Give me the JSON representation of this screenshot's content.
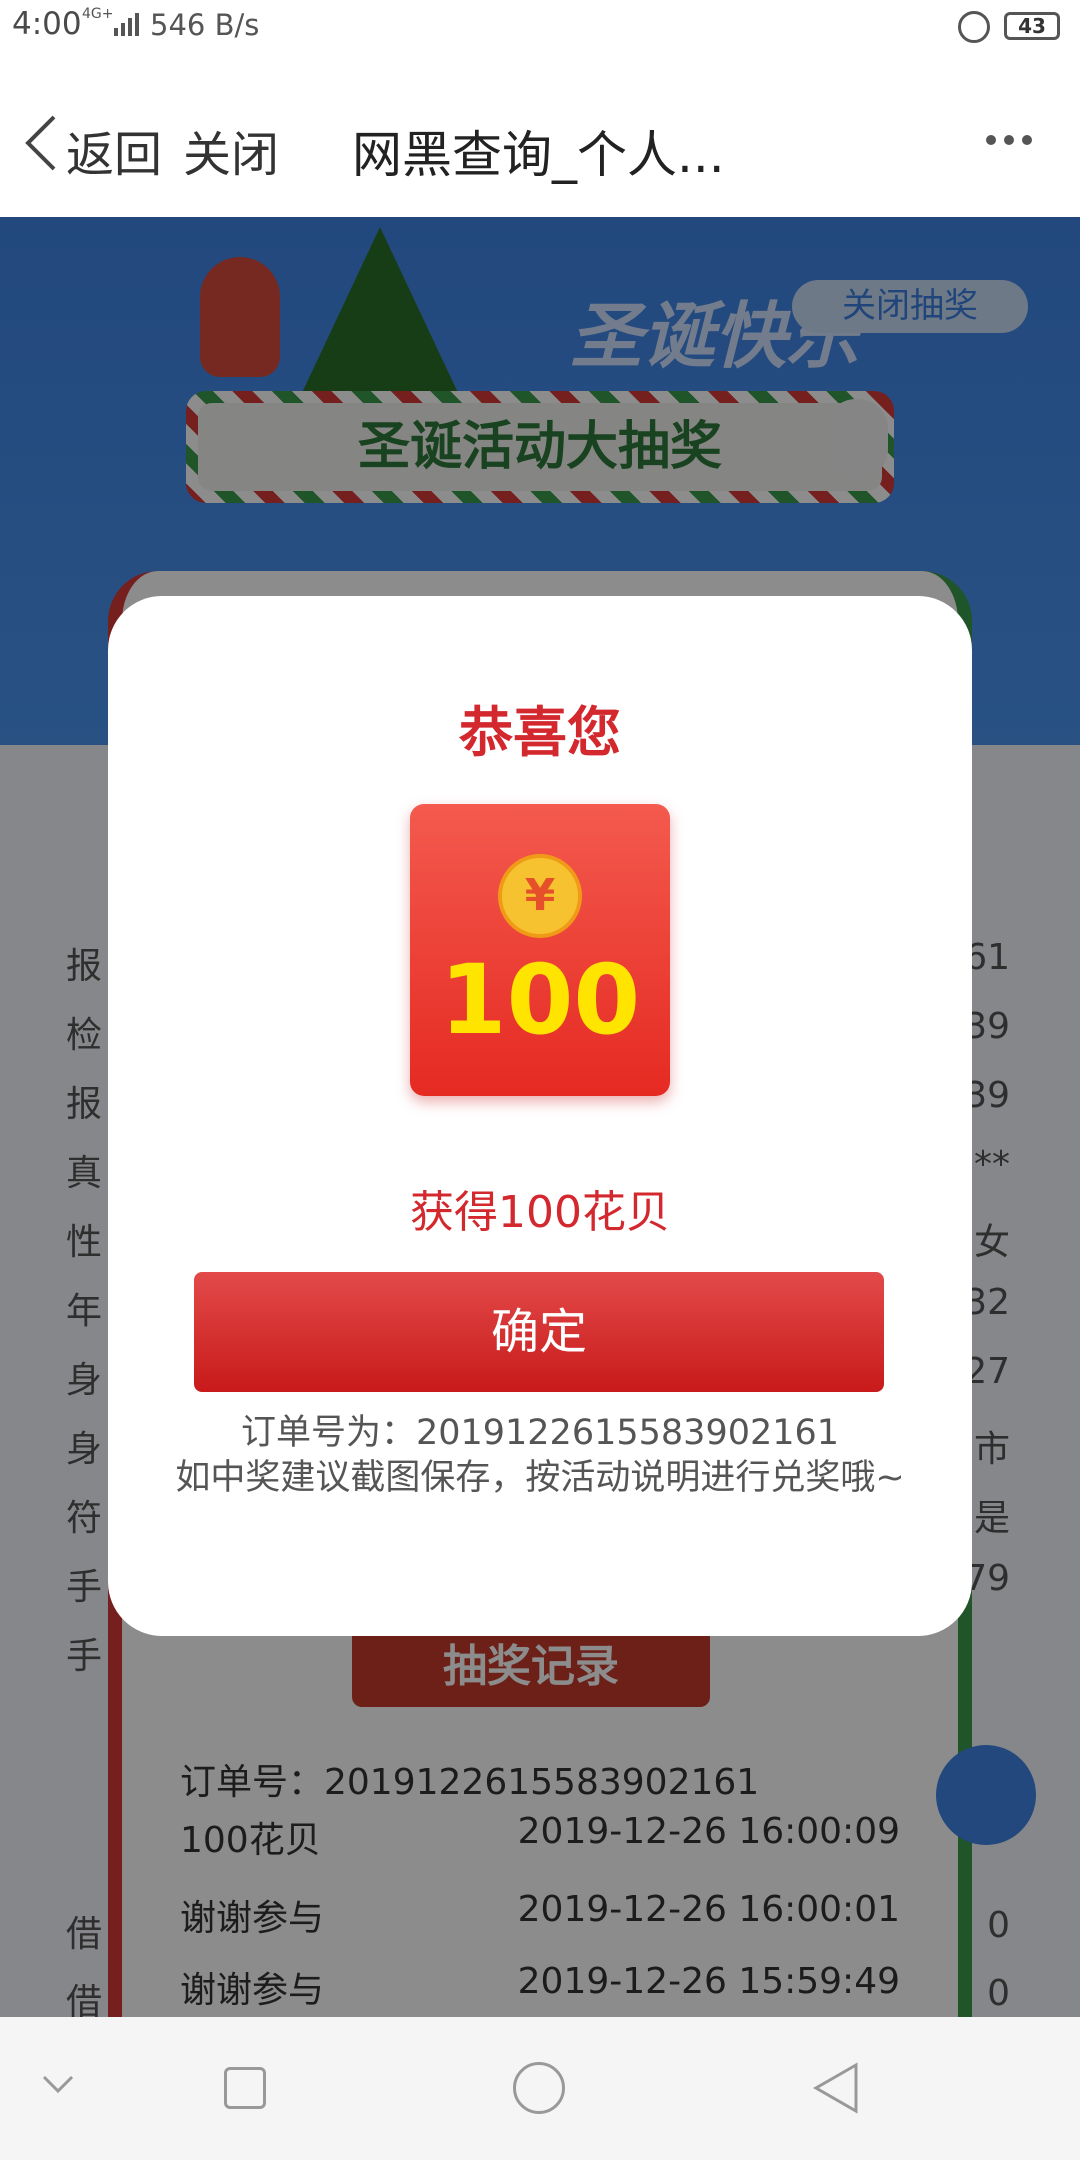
{
  "status_bar": {
    "time": "4:00",
    "network": "4G+",
    "speed": "546 B/s",
    "battery": "43"
  },
  "title_bar": {
    "back_label": "返回",
    "close_label": "关闭",
    "title": "网黑查询_个人..."
  },
  "background": {
    "xmas_title": "圣诞快乐",
    "close_lottery_label": "关闭抽奖",
    "activity_banner": "圣诞活动大抽奖",
    "left_labels": [
      "报",
      "检",
      "报",
      "真",
      "性",
      "年",
      "身",
      "身",
      "符",
      "手",
      "手"
    ],
    "right_values": [
      "61",
      "39",
      "39",
      "**",
      "女",
      "32",
      "27",
      "市",
      "是",
      "79",
      ""
    ],
    "record_tab": "抽奖记录",
    "record_order": "订单号：20191226155839021​61",
    "records": [
      {
        "name": "100花贝",
        "time": "2019-12-26 16:00:09"
      },
      {
        "name": "谢谢参与",
        "time": "2019-12-26 16:00:01"
      },
      {
        "name": "谢谢参与",
        "time": "2019-12-26 15:59:49"
      }
    ],
    "bottom_values": [
      "0",
      "0"
    ],
    "bottom_labels": [
      "借",
      "借"
    ]
  },
  "modal": {
    "title": "恭喜您",
    "coin_symbol": "¥",
    "amount": "100",
    "prize_text": "获得100花贝",
    "confirm_label": "确定",
    "order_line": "订单号为：20191226155839021​61",
    "tip": "如中奖建议截图保存，按活动说明进行兑奖哦~"
  },
  "colors": {
    "accent_red": "#d3282e",
    "banner_blue": "#3f84e6",
    "coin_gold": "#f7c22f",
    "amount_yellow": "#ffe400"
  }
}
